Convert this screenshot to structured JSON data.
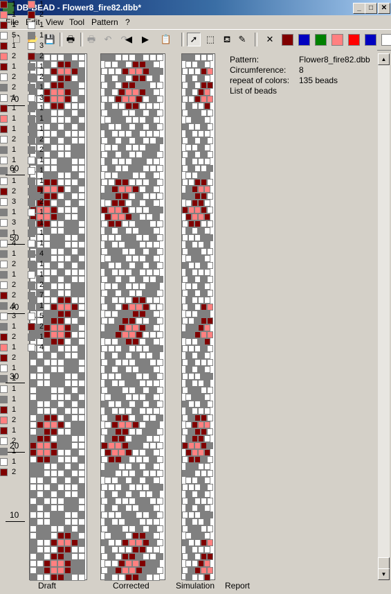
{
  "window": {
    "title": "DB-BEAD - Flower8_fire82.dbb*",
    "min": "_",
    "max": "□",
    "close": "✕"
  },
  "menu": [
    "File",
    "Edit",
    "View",
    "Tool",
    "Pattern",
    "?"
  ],
  "toolbar": {
    "icons": [
      "new-file-icon",
      "open-folder-icon",
      "save-icon",
      "print-icon",
      "print-preview-icon",
      "undo-icon",
      "redo-icon",
      "arrow-left-icon",
      "arrow-right-icon",
      "paste-icon",
      "pointer-icon",
      "select-rect-icon",
      "fill-bucket-icon",
      "pipette-icon",
      "delete-color-icon"
    ],
    "swatches": [
      "#800000",
      "#0000c0",
      "#008000",
      "#ff8080",
      "#ff0000",
      "#0000c0",
      "#ffffff"
    ]
  },
  "ruler": {
    "labels": [
      "70",
      "60",
      "50",
      "40",
      "30",
      "20",
      "10"
    ]
  },
  "views": {
    "draft": "Draft",
    "corrected": "Corrected",
    "simulation": "Simulation",
    "report": "Report"
  },
  "report": {
    "pattern_label": "Pattern:",
    "pattern_value": "Flower8_fire82.dbb",
    "circ_label": "Circumference:",
    "circ_value": "8",
    "repeat_label": "repeat of colors:",
    "repeat_value": "135 beads",
    "list_label": "List of beads",
    "col1": [
      {
        "c": "#800000",
        "n": "1"
      },
      {
        "c": "#ff8080",
        "n": "1"
      },
      {
        "c": "#800000",
        "n": "1"
      },
      {
        "c": "#ffffff",
        "n": "5"
      },
      {
        "c": "#800000",
        "n": "1"
      },
      {
        "c": "#ff8080",
        "n": "2"
      },
      {
        "c": "#800000",
        "n": "1"
      },
      {
        "c": "#ffffff",
        "n": "2"
      },
      {
        "c": "#808080",
        "n": "2"
      },
      {
        "c": "#ffffff",
        "n": "1"
      },
      {
        "c": "#800000",
        "n": "1"
      },
      {
        "c": "#ff8080",
        "n": "1"
      },
      {
        "c": "#800000",
        "n": "1"
      },
      {
        "c": "#ffffff",
        "n": "2"
      },
      {
        "c": "#808080",
        "n": "1"
      },
      {
        "c": "#ffffff",
        "n": "1"
      },
      {
        "c": "#808080",
        "n": "1"
      },
      {
        "c": "#ffffff",
        "n": "1"
      },
      {
        "c": "#800000",
        "n": "2"
      },
      {
        "c": "#ffffff",
        "n": "3"
      },
      {
        "c": "#808080",
        "n": "1"
      },
      {
        "c": "#ffffff",
        "n": "3"
      },
      {
        "c": "#808080",
        "n": "1"
      },
      {
        "c": "#ffffff",
        "n": "4"
      },
      {
        "c": "#808080",
        "n": "1"
      },
      {
        "c": "#ffffff",
        "n": "2"
      },
      {
        "c": "#808080",
        "n": "1"
      },
      {
        "c": "#ffffff",
        "n": "2"
      },
      {
        "c": "#800000",
        "n": "2"
      },
      {
        "c": "#808080",
        "n": "1"
      },
      {
        "c": "#ffffff",
        "n": "3"
      },
      {
        "c": "#808080",
        "n": "1"
      },
      {
        "c": "#800000",
        "n": "2"
      },
      {
        "c": "#ff8080",
        "n": "1"
      },
      {
        "c": "#800000",
        "n": "2"
      },
      {
        "c": "#ffffff",
        "n": "1"
      },
      {
        "c": "#808080",
        "n": "1"
      },
      {
        "c": "#ffffff",
        "n": "1"
      },
      {
        "c": "#808080",
        "n": "1"
      },
      {
        "c": "#800000",
        "n": "1"
      },
      {
        "c": "#ff8080",
        "n": "2"
      },
      {
        "c": "#800000",
        "n": "1"
      },
      {
        "c": "#ffffff",
        "n": "2"
      },
      {
        "c": "#808080",
        "n": "1"
      },
      {
        "c": "#ffffff",
        "n": "1"
      },
      {
        "c": "#800000",
        "n": "2"
      }
    ],
    "col2": [
      {
        "c": "#ff8080",
        "n": "1"
      },
      {
        "c": "#800000",
        "n": "2"
      },
      {
        "c": "#ffffff",
        "n": "1"
      },
      {
        "c": "#808080",
        "n": "1"
      },
      {
        "c": "#ffffff",
        "n": "3"
      },
      {
        "c": "#800000",
        "n": "2"
      },
      {
        "c": "#808080",
        "n": "1"
      },
      {
        "c": "#808080",
        "n": "2"
      },
      {
        "c": "#808080",
        "n": "1"
      },
      {
        "c": "#ffffff",
        "n": "3"
      },
      {
        "c": "#808080",
        "n": "1"
      },
      {
        "c": "#808080",
        "n": "1"
      },
      {
        "c": "#808080",
        "n": "1"
      },
      {
        "c": "#808080",
        "n": "2"
      },
      {
        "c": "#808080",
        "n": "2"
      },
      {
        "c": "#ffffff",
        "n": "1"
      },
      {
        "c": "#ffffff",
        "n": "1"
      },
      {
        "c": "#808080",
        "n": "1"
      },
      {
        "c": "#808080",
        "n": "1"
      },
      {
        "c": "#808080",
        "n": "2"
      },
      {
        "c": "#ffffff",
        "n": "1"
      },
      {
        "c": "#808080",
        "n": "1"
      },
      {
        "c": "#808080",
        "n": "1"
      },
      {
        "c": "#ffffff",
        "n": "1"
      },
      {
        "c": "#808080",
        "n": "4"
      },
      {
        "c": "#808080",
        "n": "1"
      },
      {
        "c": "#ffffff",
        "n": "1"
      },
      {
        "c": "#808080",
        "n": "2"
      },
      {
        "c": "#808080",
        "n": "7"
      },
      {
        "c": "#808080",
        "n": "1"
      },
      {
        "c": "#ffffff",
        "n": "5"
      },
      {
        "c": "#800000",
        "n": "2"
      },
      {
        "c": "#808080",
        "n": "1"
      },
      {
        "c": "#ffffff",
        "n": "4"
      }
    ]
  }
}
